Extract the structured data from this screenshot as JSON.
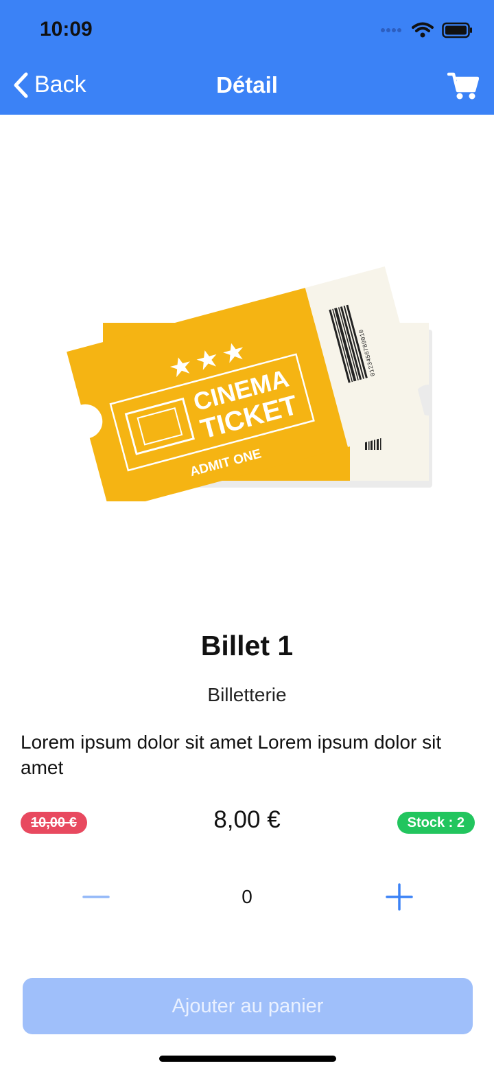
{
  "status_bar": {
    "time": "10:09"
  },
  "nav": {
    "back_label": "Back",
    "title": "Détail"
  },
  "product": {
    "image_text": {
      "line1": "CINEMA",
      "line2": "TICKET",
      "admit": "ADMIT ONE",
      "barcode_number": "0123456789010"
    },
    "name": "Billet 1",
    "category": "Billetterie",
    "description": "Lorem ipsum dolor sit amet Lorem ipsum dolor sit amet",
    "old_price": "10,00 €",
    "price": "8,00 €",
    "stock": "Stock : 2"
  },
  "quantity": {
    "value": "0"
  },
  "add_button": {
    "label": "Ajouter au panier"
  },
  "colors": {
    "header": "#3b82f6",
    "old_price_badge": "#e8495f",
    "stock_badge": "#22c55e",
    "ticket": "#f5b413",
    "button_disabled": "#9fbffa"
  },
  "icons": {
    "back": "chevron-left-icon",
    "cart": "cart-icon",
    "minus": "minus-icon",
    "plus": "plus-icon"
  }
}
